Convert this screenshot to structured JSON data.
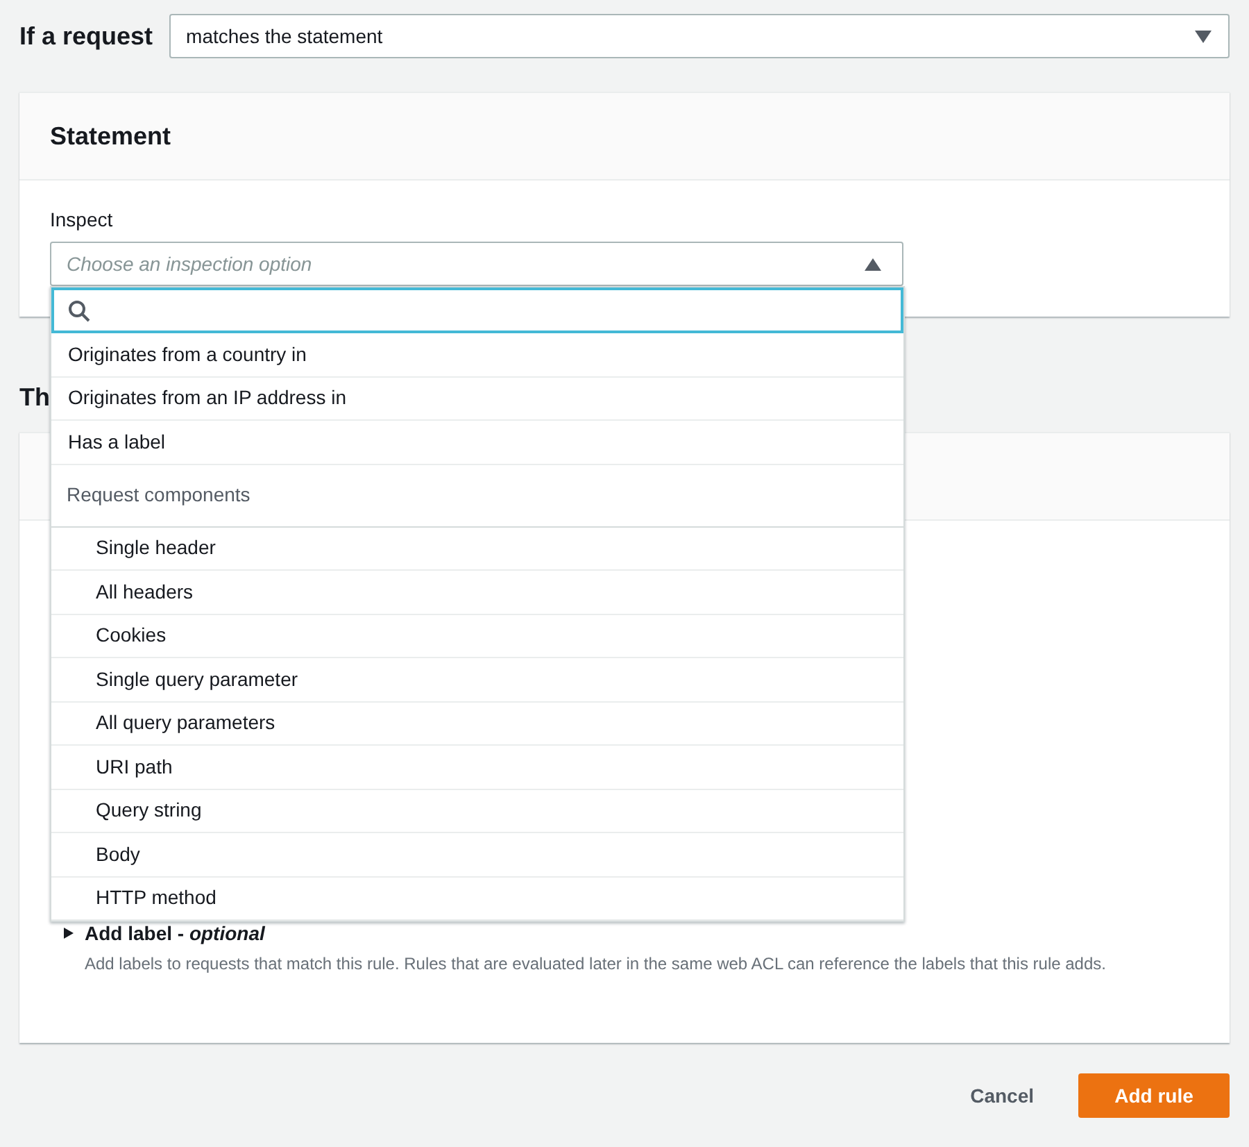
{
  "condition": {
    "label": "If a request",
    "value": "matches the statement"
  },
  "statement": {
    "title": "Statement",
    "inspect": {
      "label": "Inspect",
      "placeholder": "Choose an inspection option",
      "expanded": true
    },
    "dropdown": {
      "items": [
        {
          "kind": "option",
          "label": "Originates from a country in"
        },
        {
          "kind": "option",
          "label": "Originates from an IP address in"
        },
        {
          "kind": "option",
          "label": "Has a label"
        },
        {
          "kind": "group",
          "label": "Request components"
        },
        {
          "kind": "suboption",
          "label": "Single header"
        },
        {
          "kind": "suboption",
          "label": "All headers"
        },
        {
          "kind": "suboption",
          "label": "Cookies"
        },
        {
          "kind": "suboption",
          "label": "Single query parameter"
        },
        {
          "kind": "suboption",
          "label": "All query parameters"
        },
        {
          "kind": "suboption",
          "label": "URI path"
        },
        {
          "kind": "suboption",
          "label": "Query string"
        },
        {
          "kind": "suboption",
          "label": "Body"
        },
        {
          "kind": "suboption",
          "label": "HTTP method"
        }
      ]
    }
  },
  "next_section": {
    "title_fragment": "Th"
  },
  "add_label": {
    "title": "Add label - *optional*",
    "expanded": false,
    "description": "Add labels to requests that match this rule. Rules that are evaluated later in the same web ACL can reference the labels that this rule adds."
  },
  "buttons": [
    {
      "kind": "link",
      "label": "Cancel"
    },
    {
      "kind": "primary",
      "label": "Add rule"
    }
  ]
}
